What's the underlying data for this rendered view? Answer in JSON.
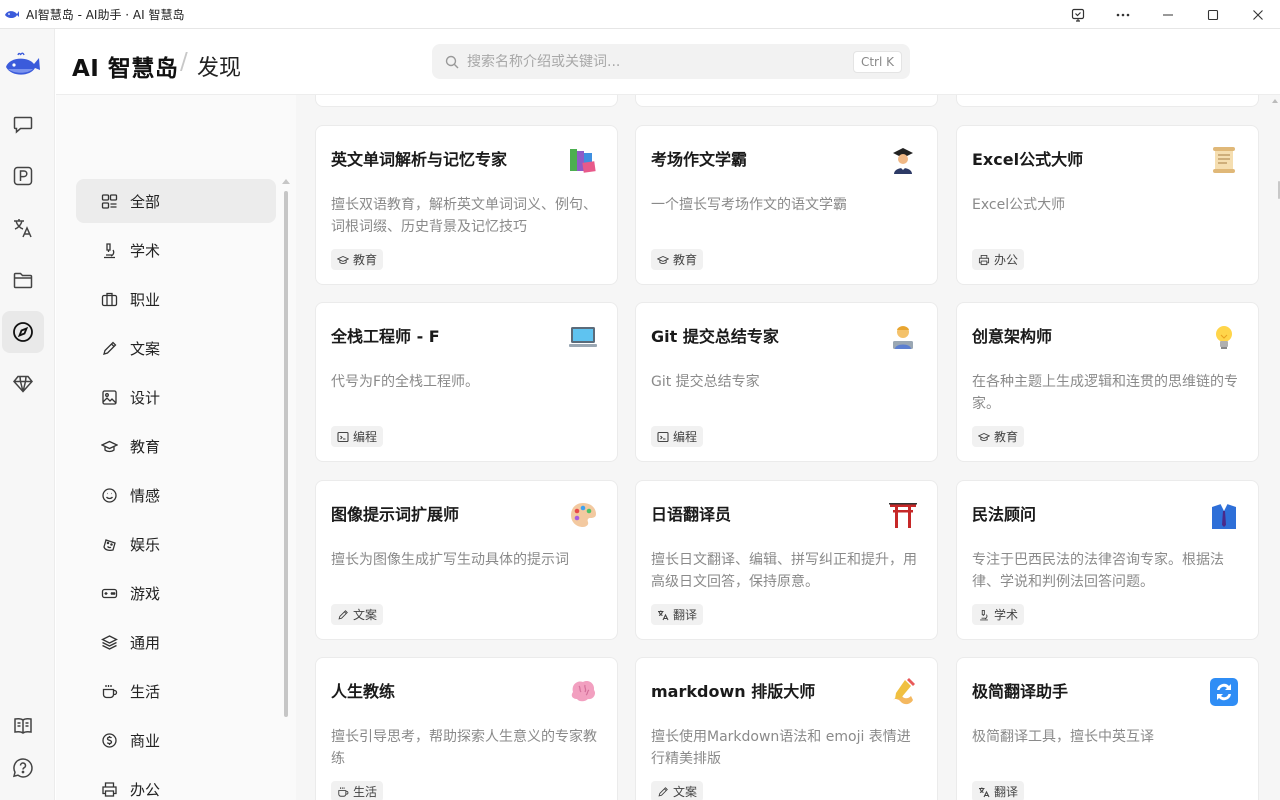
{
  "window": {
    "title": "AI智慧岛 - AI助手 · AI 智慧岛"
  },
  "header": {
    "brand": "AI 智慧岛",
    "separator": "/",
    "section": "发现"
  },
  "search": {
    "placeholder": "搜索名称介绍或关键词...",
    "shortcut": "Ctrl K"
  },
  "rail": {
    "icons": [
      "logo-whale-icon",
      "chat-icon",
      "p-icon",
      "translate-icon",
      "folder-icon",
      "compass-icon",
      "diamond-icon",
      "book-icon",
      "help-icon"
    ],
    "active": "compass-icon"
  },
  "categories": [
    {
      "label": "全部",
      "icon": "grid-icon",
      "active": true
    },
    {
      "label": "学术",
      "icon": "microscope-icon"
    },
    {
      "label": "职业",
      "icon": "briefcase-icon"
    },
    {
      "label": "文案",
      "icon": "pencil-icon"
    },
    {
      "label": "设计",
      "icon": "image-icon"
    },
    {
      "label": "教育",
      "icon": "graduation-cap-icon"
    },
    {
      "label": "情感",
      "icon": "smile-icon"
    },
    {
      "label": "娱乐",
      "icon": "palette-icon"
    },
    {
      "label": "游戏",
      "icon": "gamepad-icon"
    },
    {
      "label": "通用",
      "icon": "layers-icon"
    },
    {
      "label": "生活",
      "icon": "coffee-icon"
    },
    {
      "label": "商业",
      "icon": "dollar-icon"
    },
    {
      "label": "办公",
      "icon": "printer-icon"
    }
  ],
  "cards": [
    {
      "title": "英文单词解析与记忆专家",
      "emoji": "📚",
      "desc": "擅长双语教育，解析英文单词词义、例句、词根词缀、历史背景及记忆技巧",
      "tag": "教育",
      "tag_icon": "graduation-cap-icon"
    },
    {
      "title": "考场作文学霸",
      "emoji": "🧑‍🎓",
      "desc": "一个擅长写考场作文的语文学霸",
      "tag": "教育",
      "tag_icon": "graduation-cap-icon"
    },
    {
      "title": "Excel公式大师",
      "emoji": "📜",
      "desc": "Excel公式大师",
      "tag": "办公",
      "tag_icon": "printer-icon"
    },
    {
      "title": "全栈工程师 - F",
      "emoji": "💻",
      "desc": "代号为F的全栈工程师。",
      "tag": "编程",
      "tag_icon": "terminal-icon"
    },
    {
      "title": "Git 提交总结专家",
      "emoji": "🧑‍💻",
      "desc": "Git 提交总结专家",
      "tag": "编程",
      "tag_icon": "terminal-icon"
    },
    {
      "title": "创意架构师",
      "emoji": "💡",
      "desc": "在各种主题上生成逻辑和连贯的思维链的专家。",
      "tag": "教育",
      "tag_icon": "graduation-cap-icon"
    },
    {
      "title": "图像提示词扩展师",
      "emoji": "🎨",
      "desc": "擅长为图像生成扩写生动具体的提示词",
      "tag": "文案",
      "tag_icon": "pencil-icon"
    },
    {
      "title": "日语翻译员",
      "emoji": "⛩️",
      "desc": "擅长日文翻译、编辑、拼写纠正和提升，用高级日文回答，保持原意。",
      "tag": "翻译",
      "tag_icon": "translate-icon"
    },
    {
      "title": "民法顾问",
      "emoji": "👔",
      "desc": "专注于巴西民法的法律咨询专家。根据法律、学说和判例法回答问题。",
      "tag": "学术",
      "tag_icon": "microscope-icon"
    },
    {
      "title": "人生教练",
      "emoji": "🧠",
      "desc": "擅长引导思考，帮助探索人生意义的专家教练",
      "tag": "生活",
      "tag_icon": "coffee-icon"
    },
    {
      "title": "markdown 排版大师",
      "emoji": "✍️",
      "desc": "擅长使用Markdown语法和 emoji 表情进行精美排版",
      "tag": "文案",
      "tag_icon": "pencil-icon"
    },
    {
      "title": "极简翻译助手",
      "emoji": "🔄",
      "desc": "极简翻译工具，擅长中英互译",
      "tag": "翻译",
      "tag_icon": "translate-icon"
    }
  ],
  "colors": {
    "accent": "#3b5bdb",
    "rail_bg": "#f7f7f7",
    "main_bg": "#f6f6f6"
  }
}
